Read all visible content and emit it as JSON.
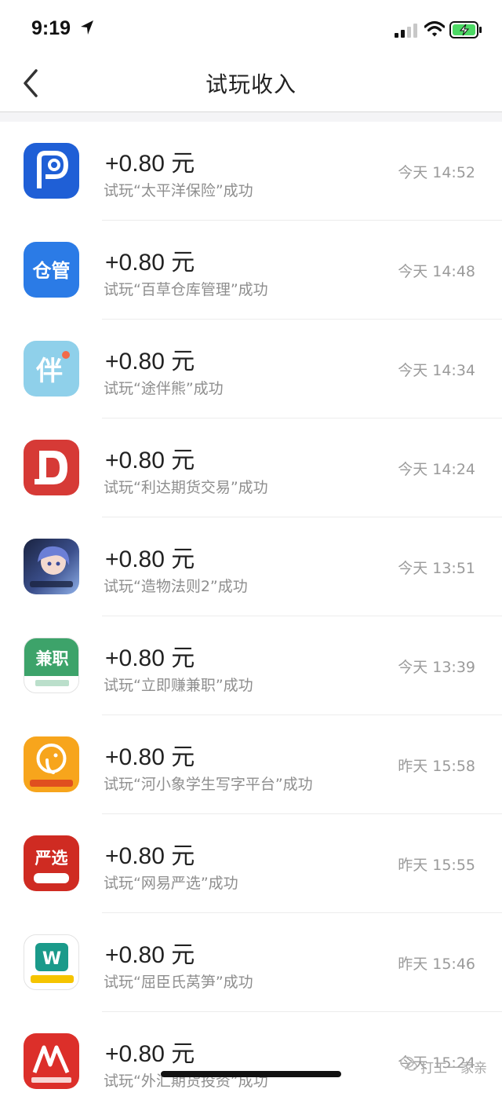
{
  "status_bar": {
    "time": "9:19"
  },
  "nav": {
    "title": "试玩收入"
  },
  "records": [
    {
      "icon": "taiping-insurance-icon",
      "glyph": "P",
      "amount": "+0.80 元",
      "desc": "试玩“太平洋保险”成功",
      "time": "今天 14:52"
    },
    {
      "icon": "baicao-warehouse-icon",
      "glyph": "仓管",
      "amount": "+0.80 元",
      "desc": "试玩“百草仓库管理”成功",
      "time": "今天 14:48"
    },
    {
      "icon": "tubanxiong-icon",
      "glyph": "伴",
      "amount": "+0.80 元",
      "desc": "试玩“途伴熊”成功",
      "time": "今天 14:34"
    },
    {
      "icon": "lida-futures-icon",
      "glyph": "D",
      "amount": "+0.80 元",
      "desc": "试玩“利达期货交易”成功",
      "time": "今天 14:24"
    },
    {
      "icon": "zaowu-game-icon",
      "glyph": "",
      "amount": "+0.80 元",
      "desc": "试玩“造物法则2”成功",
      "time": "今天 13:51"
    },
    {
      "icon": "parttime-job-icon",
      "glyph": "兼职",
      "amount": "+0.80 元",
      "desc": "试玩“立即赚兼职”成功",
      "time": "今天 13:39"
    },
    {
      "icon": "elephant-writing-icon",
      "glyph": "",
      "amount": "+0.80 元",
      "desc": "试玩“河小象学生写字平台”成功",
      "time": "昨天 15:58"
    },
    {
      "icon": "netease-yanxuan-icon",
      "glyph": "严选",
      "amount": "+0.80 元",
      "desc": "试玩“网易严选”成功",
      "time": "昨天 15:55"
    },
    {
      "icon": "watsons-icon",
      "glyph": "W",
      "amount": "+0.80 元",
      "desc": "试玩“屈臣氏莴笋”成功",
      "time": "昨天 15:46"
    },
    {
      "icon": "forex-futures-icon",
      "glyph": "",
      "amount": "+0.80 元",
      "desc": "试玩“外汇期货投资”成功",
      "time": "今天 15:24"
    }
  ],
  "watermark": "打工一家亲",
  "colors": {
    "accent_blue": "#1f6fe0",
    "text_gray": "#8e8e8e"
  }
}
